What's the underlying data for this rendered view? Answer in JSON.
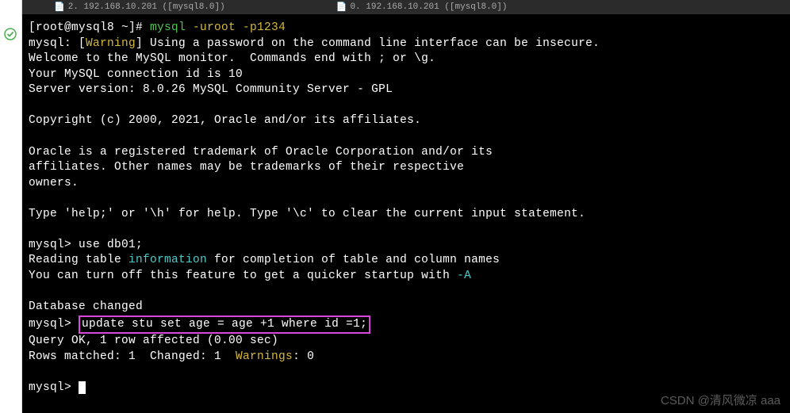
{
  "tabs": {
    "tab1": "2. 192.168.10.201 ([mysql8.0])",
    "tab2": "0. 192.168.10.201 ([mysql8.0])"
  },
  "terminal": {
    "prompt_user": "[root@mysql8 ~]# ",
    "cmd1": "mysql ",
    "cmd1_args": "-uroot -p1234",
    "line_warn_prefix": "mysql: [",
    "line_warn_word": "Warning",
    "line_warn_suffix": "] Using a password on the command line interface can be insecure.",
    "line3": "Welcome to the MySQL monitor.  Commands end with ; or \\g.",
    "line4": "Your MySQL connection id is 10",
    "line5": "Server version: 8.0.26 MySQL Community Server - GPL",
    "line6": "Copyright (c) 2000, 2021, Oracle and/or its affiliates.",
    "line7": "Oracle is a registered trademark of Oracle Corporation and/or its",
    "line8": "affiliates. Other names may be trademarks of their respective",
    "line9": "owners.",
    "line10": "Type 'help;' or '\\h' for help. Type '\\c' to clear the current input statement.",
    "mysql_prompt": "mysql> ",
    "cmd_use": "use db01;",
    "line_reading_pre": "Reading table ",
    "line_reading_info": "information",
    "line_reading_post": " for completion of table and column names",
    "line_turnoff_pre": "You can turn off this feature to get a quicker startup with ",
    "line_turnoff_flag": "-A",
    "line_dbchanged": "Database changed",
    "cmd_update": "update stu set age = age +1 where id =1;",
    "line_queryok": "Query OK, 1 row affected (0.00 sec)",
    "line_rows_pre": "Rows matched: 1  Changed: 1  ",
    "line_rows_warn": "Warnings",
    "line_rows_post": ": 0"
  },
  "watermark": "CSDN @清风微凉 aaa"
}
